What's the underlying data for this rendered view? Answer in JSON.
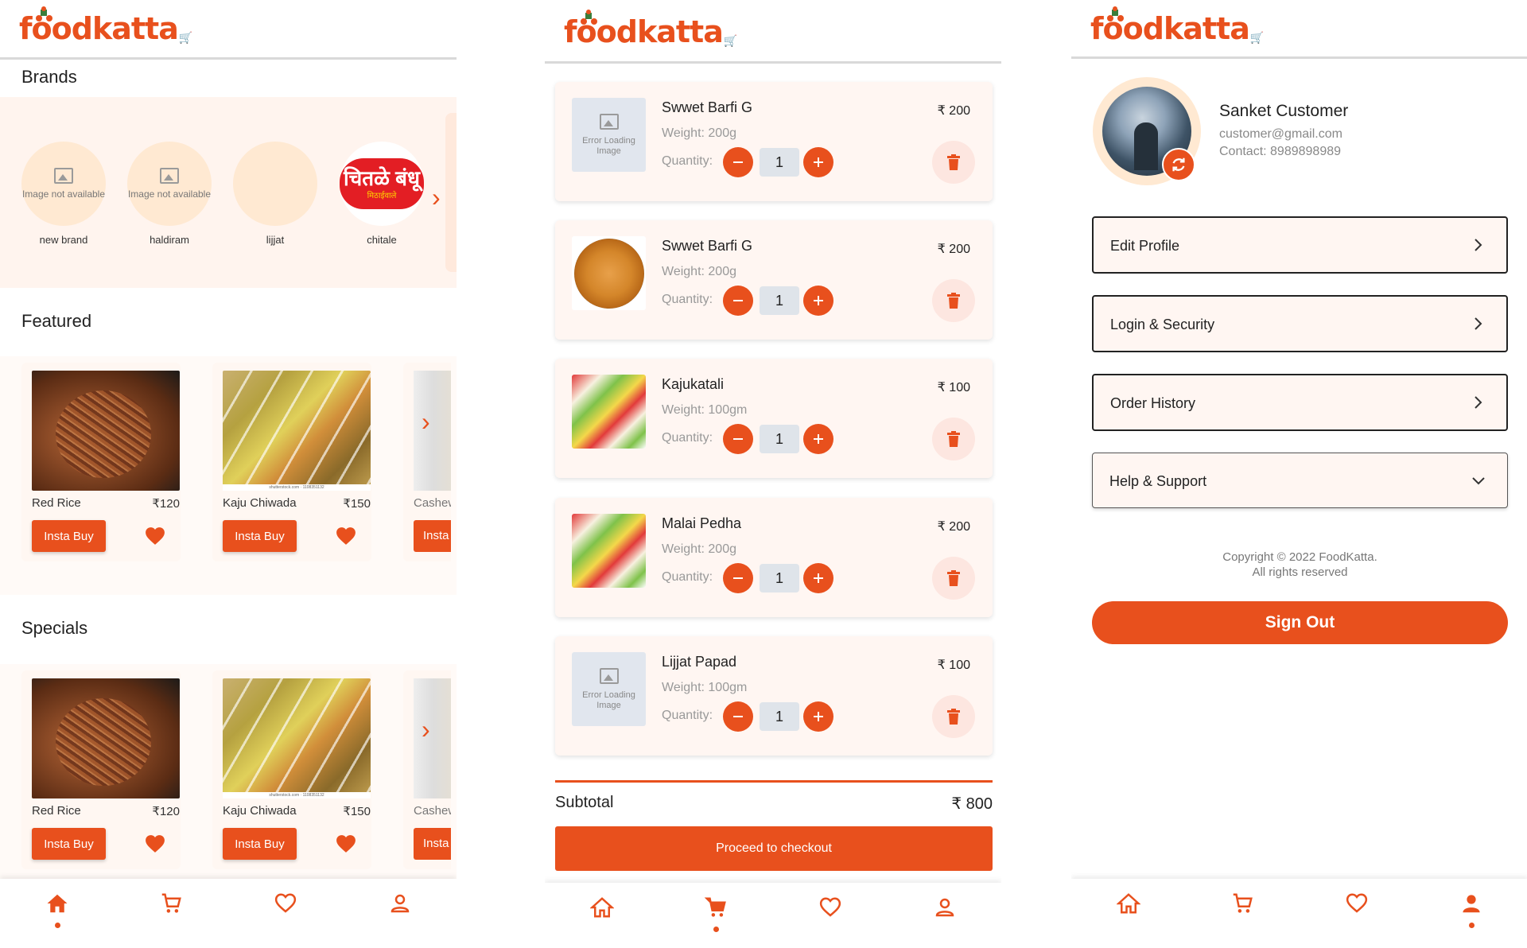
{
  "app": {
    "name": "foodkatta",
    "cart_glyph": "🛒",
    "accent": "#e8501d",
    "icons": [
      "rider-icon",
      "cart-icon",
      "image-placeholder-icon",
      "chevron-right-icon",
      "heart-icon",
      "home-icon",
      "favorites-icon",
      "profile-icon",
      "minus-icon",
      "plus-icon",
      "trash-icon",
      "refresh-icon",
      "chevron-down-icon"
    ]
  },
  "home": {
    "brands_title": "Brands",
    "brands": [
      {
        "name": "new brand",
        "placeholder": "Image not available"
      },
      {
        "name": "haldiram",
        "placeholder": "Image not available"
      },
      {
        "name": "lijjat",
        "placeholder": ""
      },
      {
        "name": "chitale",
        "logo_main": "चितळे बंधू",
        "logo_sub": "मिठाईवाले"
      }
    ],
    "featured_title": "Featured",
    "specials_title": "Specials",
    "featured": [
      {
        "name": "Red Rice",
        "price": "₹120",
        "button": "Insta Buy"
      },
      {
        "name": "Kaju Chiwada",
        "price": "₹150",
        "button": "Insta Buy"
      },
      {
        "name": "Cashew",
        "button": "Insta Buy"
      }
    ],
    "specials": [
      {
        "name": "Red Rice",
        "price": "₹120",
        "button": "Insta Buy"
      },
      {
        "name": "Kaju Chiwada",
        "price": "₹150",
        "button": "Insta Buy"
      },
      {
        "name": "Cashew",
        "button": "Insta Buy"
      }
    ],
    "image_credit": "shutterstock.com · 1108351132"
  },
  "cart": {
    "error_image_text": "Error Loading Image",
    "weight_prefix": "Weight: ",
    "quantity_label": "Quantity:",
    "items": [
      {
        "name": "Swwet Barfi G",
        "weight": "Weight: 200g",
        "qty": "1",
        "price": "₹ 200"
      },
      {
        "name": "Swwet Barfi G",
        "weight": "Weight: 200g",
        "qty": "1",
        "price": "₹ 200"
      },
      {
        "name": "Kajukatali",
        "weight": "Weight: 100gm",
        "qty": "1",
        "price": "₹ 100"
      },
      {
        "name": "Malai Pedha",
        "weight": "Weight: 200g",
        "qty": "1",
        "price": "₹ 200"
      },
      {
        "name": "Lijjat Papad",
        "weight": "Weight: 100gm",
        "qty": "1",
        "price": "₹ 100"
      }
    ],
    "subtotal_label": "Subtotal",
    "subtotal_value": "₹ 800",
    "checkout_label": "Proceed to checkout"
  },
  "profile": {
    "name": "Sanket Customer",
    "email": "customer@gmail.com",
    "contact": "Contact: 8989898989",
    "menu": [
      {
        "label": "Edit Profile"
      },
      {
        "label": "Login & Security"
      },
      {
        "label": "Order History"
      },
      {
        "label": "Help & Support"
      }
    ],
    "copyright_line1": "Copyright © 2022 FoodKatta.",
    "copyright_line2": "All rights reserved",
    "signout_label": "Sign Out"
  }
}
